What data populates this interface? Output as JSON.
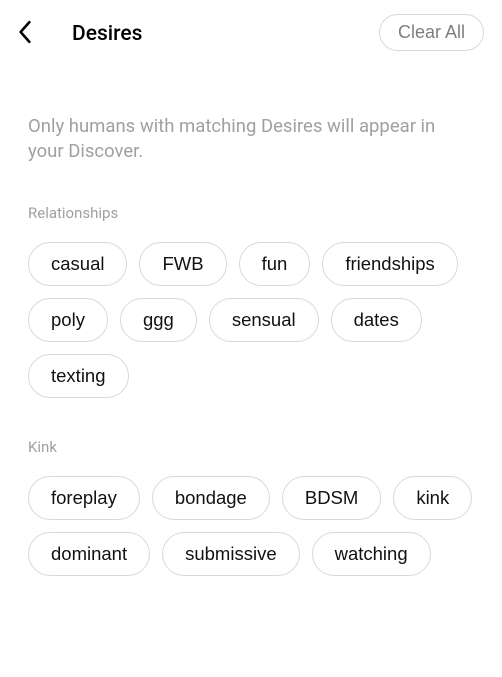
{
  "header": {
    "title": "Desires",
    "clear_label": "Clear All"
  },
  "description": "Only humans with matching Desires will appear in your Discover.",
  "sections": [
    {
      "title": "Relationships",
      "chips": [
        "casual",
        "FWB",
        "fun",
        "friendships",
        "poly",
        "ggg",
        "sensual",
        "dates",
        "texting"
      ]
    },
    {
      "title": "Kink",
      "chips": [
        "foreplay",
        "bondage",
        "BDSM",
        "kink",
        "dominant",
        "submissive",
        "watching"
      ]
    }
  ]
}
